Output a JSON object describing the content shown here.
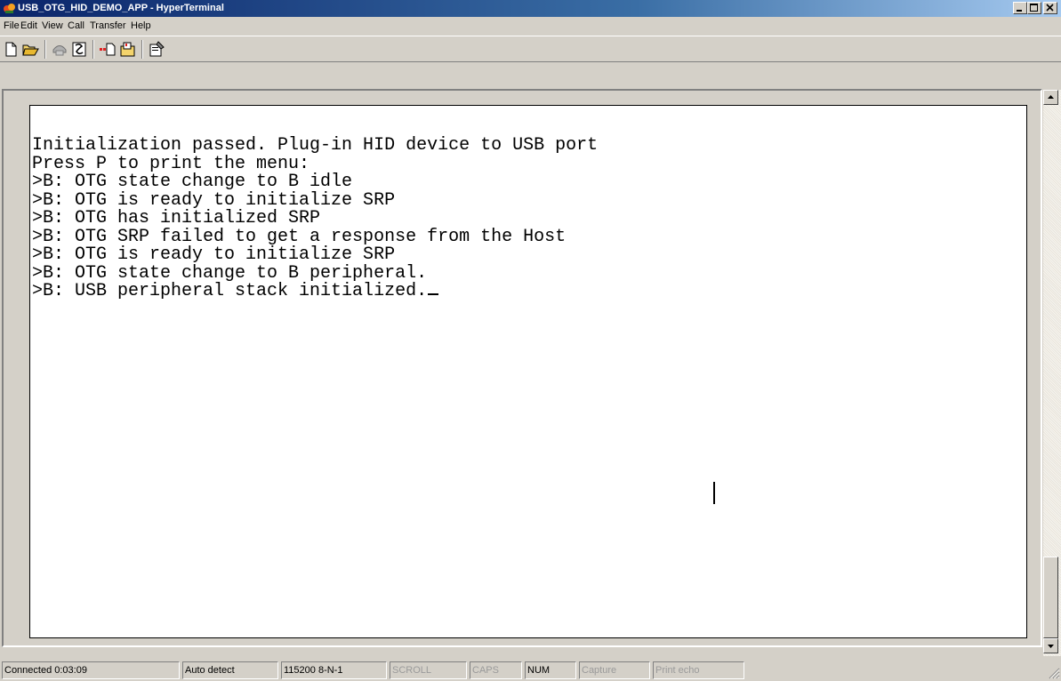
{
  "window": {
    "title": "USB_OTG_HID_DEMO_APP - HyperTerminal"
  },
  "menu": [
    "File",
    "Edit",
    "View",
    "Call",
    "Transfer",
    "Help"
  ],
  "toolbar": {
    "buttons": [
      "new-icon",
      "open-icon",
      "disconnect-icon",
      "dial-icon",
      "send-icon",
      "receive-icon",
      "properties-icon"
    ]
  },
  "terminal": {
    "lines": [
      "Initialization passed. Plug-in HID device to USB port",
      "Press P to print the menu:",
      ">B: OTG state change to B idle",
      ">B: OTG is ready to initialize SRP",
      ">B: OTG has initialized SRP",
      ">B: OTG SRP failed to get a response from the Host",
      ">B: OTG is ready to initialize SRP",
      ">B: OTG state change to B peripheral.",
      ">B: USB peripheral stack initialized."
    ]
  },
  "status": {
    "connected": "Connected 0:03:09",
    "detect": "Auto detect",
    "port": "115200 8-N-1",
    "scroll": "SCROLL",
    "caps": "CAPS",
    "num": "NUM",
    "capture": "Capture",
    "print_echo": "Print echo"
  },
  "colors": {
    "titlebar_start": "#0a246a",
    "titlebar_end": "#a6caf0",
    "face": "#d4d0c8"
  }
}
